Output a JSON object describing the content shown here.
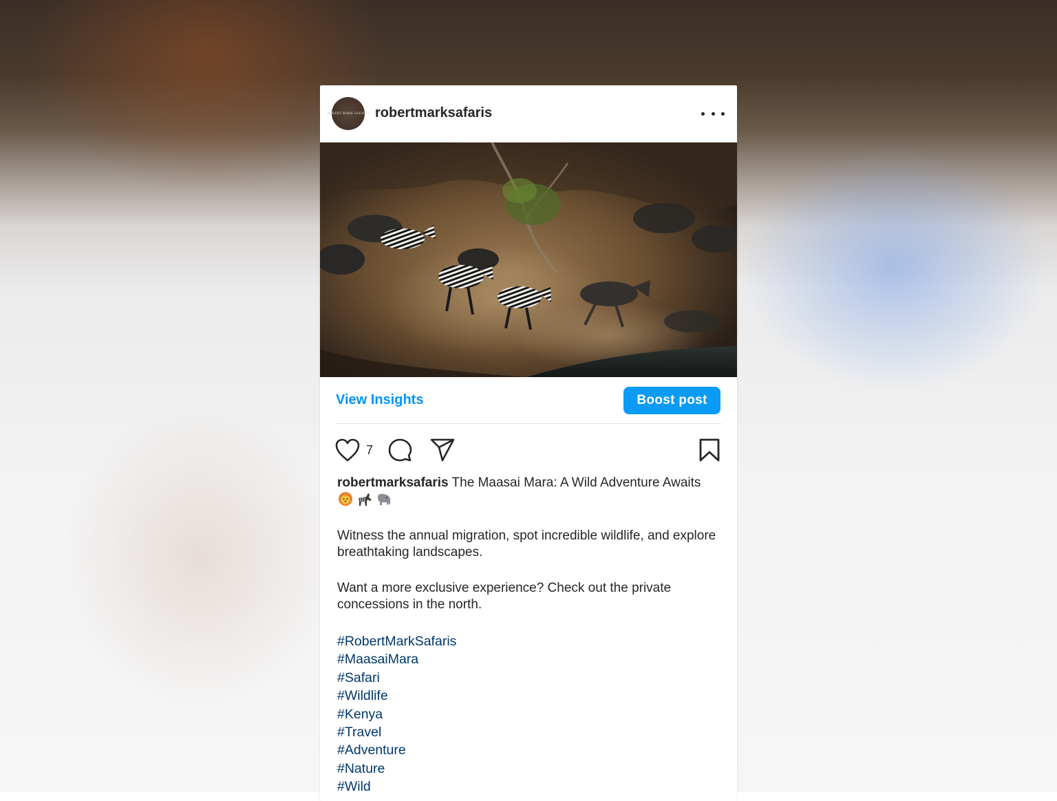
{
  "post": {
    "username": "robertmarksafaris",
    "avatar_label": "ROBERT MARK SAFARIS",
    "more_icon": "more-horizontal-icon",
    "image_alt": "Zebras and wildebeest charging down a dusty riverbank"
  },
  "actions": {
    "view_insights": "View Insights",
    "boost_post": "Boost post",
    "like_icon": "heart-icon",
    "like_count": "7",
    "comment_icon": "comment-icon",
    "share_icon": "send-icon",
    "save_icon": "bookmark-icon"
  },
  "caption": {
    "author": "robertmarksafaris",
    "headline": "The Maasai Mara: A Wild Adventure Awaits",
    "emojis": [
      "lion-emoji",
      "zebra-emoji",
      "elephant-emoji"
    ],
    "paragraph_1": "Witness the annual migration, spot incredible wildlife, and explore breathtaking landscapes.",
    "paragraph_2": "Want a more exclusive experience? Check out the private concessions in the north.",
    "hashtags": [
      "#RobertMarkSafaris",
      "#MaasaiMara",
      "#Safari",
      "#Wildlife",
      "#Kenya",
      "#Travel",
      "#Adventure",
      "#Nature",
      "#Wild"
    ]
  },
  "colors": {
    "accent": "#0095f6",
    "hashtag": "#00376b",
    "text": "#262626"
  }
}
